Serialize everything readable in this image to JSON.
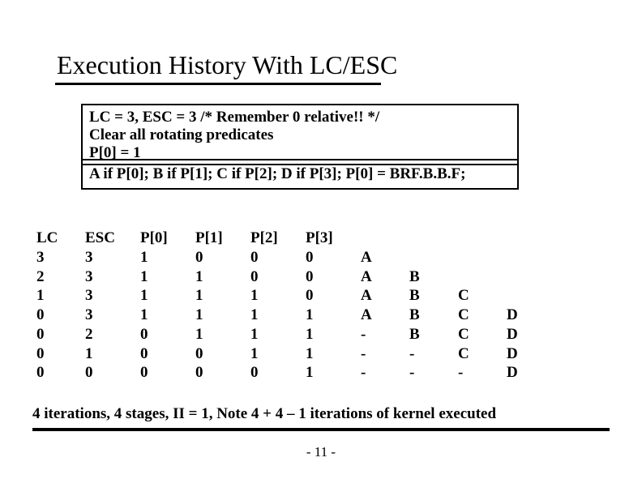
{
  "title": "Execution History With LC/ESC",
  "setup": {
    "line1": "LC = 3, ESC = 3 /* Remember 0 relative!! */",
    "line2": "Clear all rotating predicates",
    "line3": "P[0] = 1"
  },
  "loop_body": "A if P[0];  B if P[1];  C if P[2];  D if P[3];  P[0] = BRF.B.B.F;",
  "table": {
    "headers": [
      "LC",
      "ESC",
      "P[0]",
      "P[1]",
      "P[2]",
      "P[3]",
      "",
      "",
      "",
      ""
    ],
    "rows": [
      [
        "3",
        "3",
        "1",
        "0",
        "0",
        "0",
        "A",
        "",
        "",
        ""
      ],
      [
        "2",
        "3",
        "1",
        "1",
        "0",
        "0",
        "A",
        "B",
        "",
        ""
      ],
      [
        "1",
        "3",
        "1",
        "1",
        "1",
        "0",
        "A",
        "B",
        "C",
        ""
      ],
      [
        "0",
        "3",
        "1",
        "1",
        "1",
        "1",
        "A",
        "B",
        "C",
        "D"
      ],
      [
        "0",
        "2",
        "0",
        "1",
        "1",
        "1",
        "-",
        "B",
        "C",
        "D"
      ],
      [
        "0",
        "1",
        "0",
        "0",
        "1",
        "1",
        "-",
        "-",
        "C",
        "D"
      ],
      [
        "0",
        "0",
        "0",
        "0",
        "0",
        "1",
        "-",
        "-",
        "-",
        "D"
      ]
    ]
  },
  "footnote": "4 iterations, 4 stages, II = 1, Note 4 + 4 – 1 iterations of kernel executed",
  "page_number": "- 11 -"
}
